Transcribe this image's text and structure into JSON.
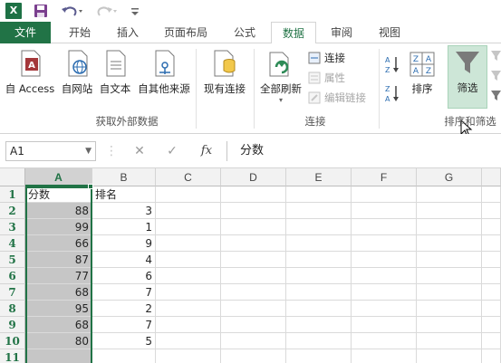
{
  "qat": {
    "app_icon": "X"
  },
  "tabs": [
    "文件",
    "开始",
    "插入",
    "页面布局",
    "公式",
    "数据",
    "审阅",
    "视图"
  ],
  "ribbon": {
    "get_external": {
      "buttons": [
        "自 Access",
        "自网站",
        "自文本",
        "自其他来源",
        "现有连接"
      ],
      "group_label": "获取外部数据"
    },
    "connections": {
      "refresh_all": "全部刷新",
      "small": [
        "连接",
        "属性",
        "编辑链接"
      ],
      "group_label": "连接"
    },
    "sort_filter": {
      "sort": "排序",
      "filter": "筛选",
      "group_label": "排序和筛选"
    }
  },
  "formula_bar": {
    "name_box": "A1",
    "cancel_glyph": "✕",
    "enter_glyph": "✓",
    "fx_glyph": "fx",
    "content": "分数"
  },
  "sheet": {
    "columns": [
      "A",
      "B",
      "C",
      "D",
      "E",
      "F",
      "G"
    ],
    "rows": [
      "1",
      "2",
      "3",
      "4",
      "5",
      "6",
      "7",
      "8",
      "9",
      "10",
      "11"
    ],
    "colA": [
      "分数",
      "88",
      "99",
      "66",
      "87",
      "77",
      "68",
      "95",
      "68",
      "80",
      ""
    ],
    "colB": [
      "排名",
      "3",
      "1",
      "9",
      "4",
      "6",
      "7",
      "2",
      "7",
      "5",
      ""
    ]
  },
  "colors": {
    "accent": "#217346",
    "selection": "#c6c6c6"
  }
}
